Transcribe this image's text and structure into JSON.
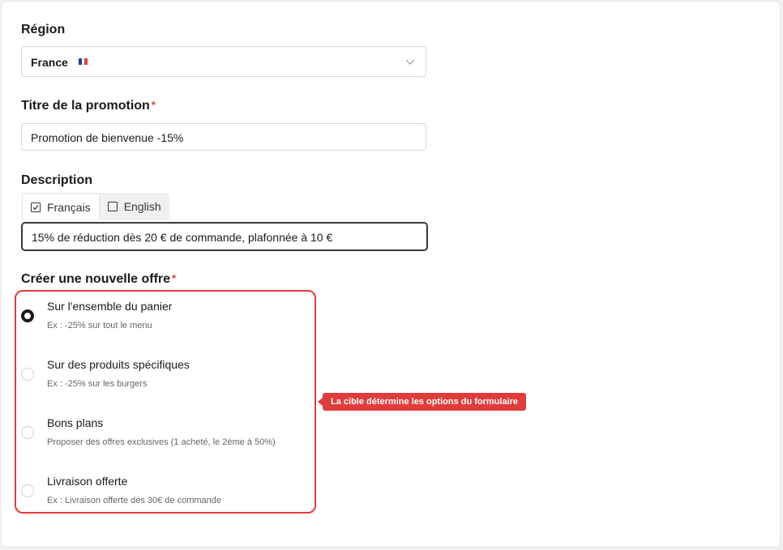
{
  "region": {
    "label": "Région",
    "selected": "France",
    "flag_colors": [
      "#1f3e9c",
      "#ffffff",
      "#e03c3c"
    ]
  },
  "title_field": {
    "label": "Titre de la promotion",
    "required_mark": "*",
    "value": "Promotion de bienvenue -15%"
  },
  "description": {
    "label": "Description",
    "tabs": [
      {
        "label": "Français",
        "checked": true
      },
      {
        "label": "English",
        "checked": false
      }
    ],
    "value": "15% de réduction dès 20 € de commande, plafonnée à 10 €"
  },
  "offer": {
    "label": "Créer une nouvelle offre",
    "required_mark": "*",
    "options": [
      {
        "title": "Sur l'ensemble du panier",
        "subtitle": "Ex : -25% sur tout le menu",
        "selected": true
      },
      {
        "title": "Sur des produits spécifiques",
        "subtitle": "Ex : -25% sur les burgers",
        "selected": false
      },
      {
        "title": "Bons plans",
        "subtitle": "Proposer des offres exclusives (1 acheté, le 2ème à 50%)",
        "selected": false
      },
      {
        "title": "Livraison offerte",
        "subtitle": "Ex : Livraison offerte dès 30€ de commande",
        "selected": false
      }
    ]
  },
  "tooltip": {
    "text": "La cible détermine les options du formulaire"
  },
  "colors": {
    "accent_red": "#e03c3c",
    "focus_border": "#3a3a3a"
  }
}
